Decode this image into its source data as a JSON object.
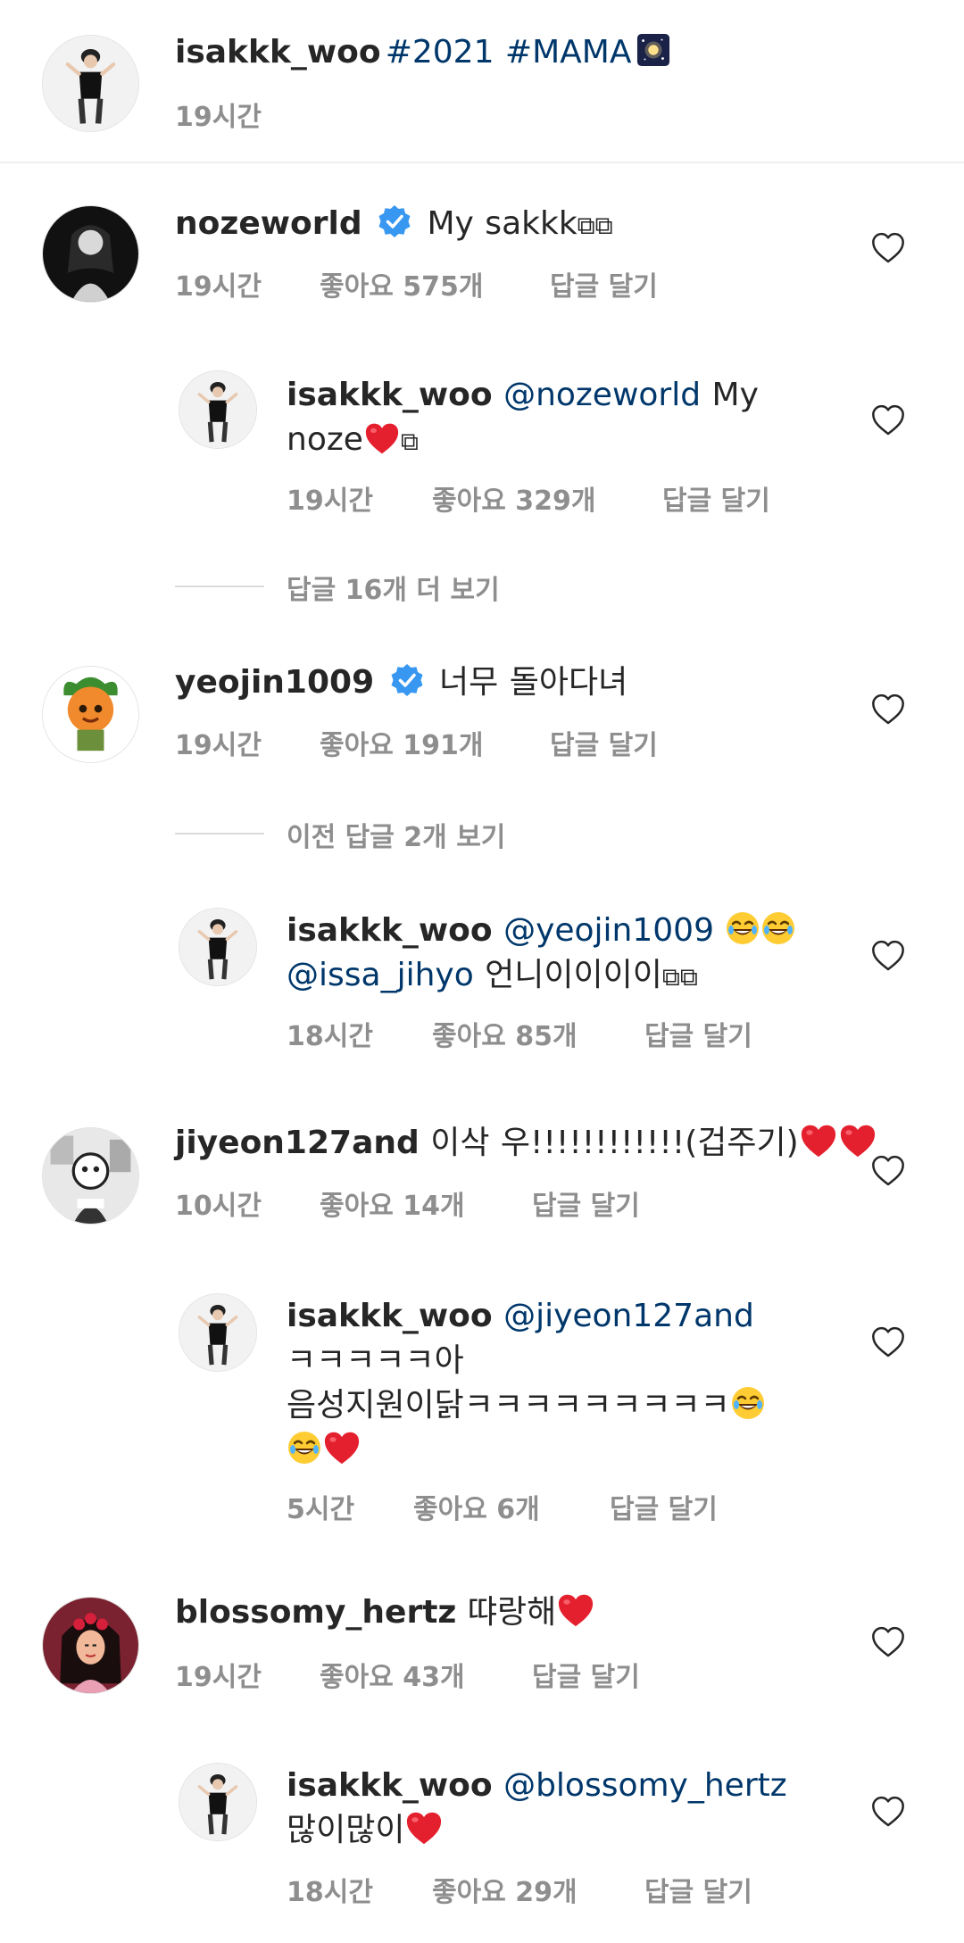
{
  "post": {
    "username": "isakkk_woo",
    "caption_tags": "#2021 #MAMA",
    "caption_emoji": "🌌",
    "time": "19시간"
  },
  "comments": [
    {
      "username": "nozeworld",
      "verified": true,
      "text": "My sakkk",
      "trail": "⧉⧉",
      "time": "19시간",
      "likes": "좋아요 575개",
      "reply_label": "답글 달기"
    },
    {
      "username": "isakkk_woo",
      "mention": "@nozeworld",
      "text_after_mention": " My",
      "line2": "noze",
      "line2_trail": "⧉",
      "time": "19시간",
      "likes": "좋아요 329개",
      "reply_label": "답글 달기"
    },
    {
      "view_more": "답글 16개 더 보기"
    },
    {
      "username": "yeojin1009",
      "verified": true,
      "text": "너무 돌아다녀",
      "time": "19시간",
      "likes": "좋아요 191개",
      "reply_label": "답글 달기"
    },
    {
      "view_more": "이전 답글 2개 보기"
    },
    {
      "username": "isakkk_woo",
      "mention": "@yeojin1009",
      "mention2": "@issa_jihyo",
      "line2_text": " 언니이이이이",
      "line2_trail": "⧉⧉",
      "time": "18시간",
      "likes": "좋아요 85개",
      "reply_label": "답글 달기"
    },
    {
      "username": "jiyeon127and",
      "text": "이삭 우!!!!!!!!!!!!(겁주기)",
      "time": "10시간",
      "likes": "좋아요 14개",
      "reply_label": "답글 달기"
    },
    {
      "username": "isakkk_woo",
      "mention": "@jiyeon127and",
      "line2": "ㅋㅋㅋㅋㅋ아",
      "line3": "음성지원이닭ㅋㅋㅋㅋㅋㅋㅋㅋㅋ",
      "time": "5시간",
      "likes": "좋아요 6개",
      "reply_label": "답글 달기"
    },
    {
      "username": "blossomy_hertz",
      "text": "땨랑해",
      "time": "19시간",
      "likes": "좋아요 43개",
      "reply_label": "답글 달기"
    },
    {
      "username": "isakkk_woo",
      "mention": "@blossomy_hertz",
      "line2": "많이많이",
      "time": "18시간",
      "likes": "좋아요 29개",
      "reply_label": "답글 달기"
    }
  ],
  "icons": {
    "heart": "heart-outline-icon",
    "verified": "verified-badge-icon",
    "emoji_laugh": "😂",
    "emoji_heart": "❤️",
    "emoji_galaxy": "🌌"
  },
  "colors": {
    "text": "#262626",
    "secondary": "#8e8e8e",
    "link": "#00376b",
    "verified": "#3897f0",
    "heart_red": "#e5202e"
  }
}
